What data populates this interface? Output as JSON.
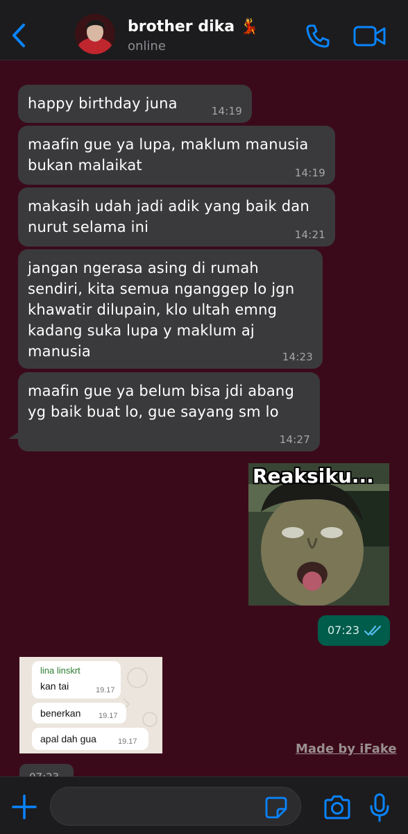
{
  "header": {
    "contact_name": "brother dika",
    "contact_emoji": "💃",
    "status": "online"
  },
  "messages": [
    {
      "text": "happy birthday juna",
      "time": "14:19"
    },
    {
      "text": "maafin gue ya lupa, maklum manusia bukan malaikat",
      "time": "14:19"
    },
    {
      "text": "makasih udah jadi adik yang baik dan nurut selama ini",
      "time": "14:21"
    },
    {
      "text": "jangan ngerasa asing di rumah sendiri, kita semua nganggep lo jgn khawatir dilupain, klo ultah emng kadang suka lupa y maklum aj manusia",
      "time": "14:23"
    },
    {
      "text": "maafin gue ya belum bisa jdi abang yg baik buat lo, gue sayang sm lo",
      "time": "14:27"
    }
  ],
  "sent_sticker": {
    "caption": "Reaksiku...",
    "time": "07:23",
    "status_icon": "double-check-icon"
  },
  "received_image": {
    "sender": "lina linskrt",
    "lines": [
      {
        "text": "kan tai",
        "time": "19.17"
      },
      {
        "text": "benerkan",
        "time": "19.17"
      },
      {
        "text": "apal dah gua",
        "time": "19.17"
      }
    ]
  },
  "watermark": "Made by iFake",
  "partial_time": "07:23",
  "input": {
    "value": "",
    "placeholder": ""
  },
  "colors": {
    "background": "#3b0a1a",
    "bubble_in": "#3a3a3c",
    "bubble_out": "#005c4b",
    "accent": "#0a84ff"
  }
}
